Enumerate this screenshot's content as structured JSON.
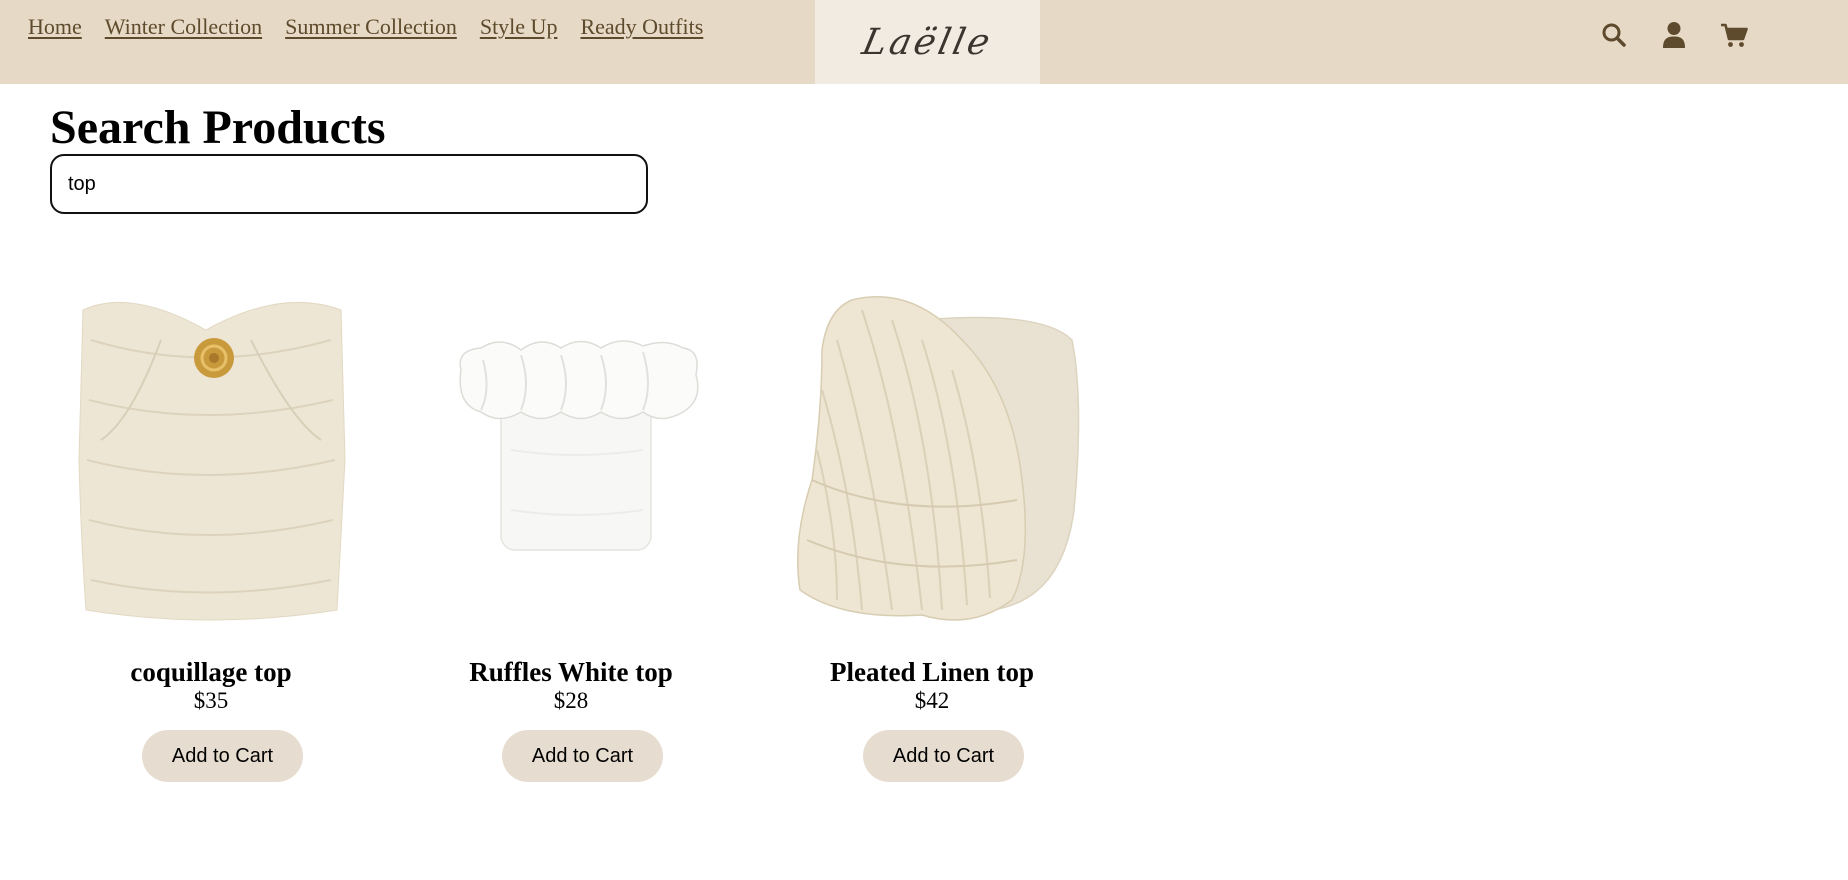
{
  "nav": {
    "links": [
      "Home",
      "Winter Collection",
      "Summer Collection",
      "Style Up",
      "Ready Outfits"
    ]
  },
  "logo": {
    "text": "Laëlle"
  },
  "header_icons": [
    "search-icon",
    "user-icon",
    "cart-icon"
  ],
  "page": {
    "title": "Search Products"
  },
  "search": {
    "value": "top"
  },
  "products": [
    {
      "name": "coquillage top",
      "price": "$35",
      "button": "Add to Cart"
    },
    {
      "name": "Ruffles White top",
      "price": "$28",
      "button": "Add to Cart"
    },
    {
      "name": "Pleated Linen top",
      "price": "$42",
      "button": "Add to Cart"
    }
  ],
  "colors": {
    "header_bg": "#e6d9c5",
    "logo_bg": "#f1ebe2",
    "nav_text": "#5e4a2c",
    "button_bg": "#e6ddd0"
  }
}
